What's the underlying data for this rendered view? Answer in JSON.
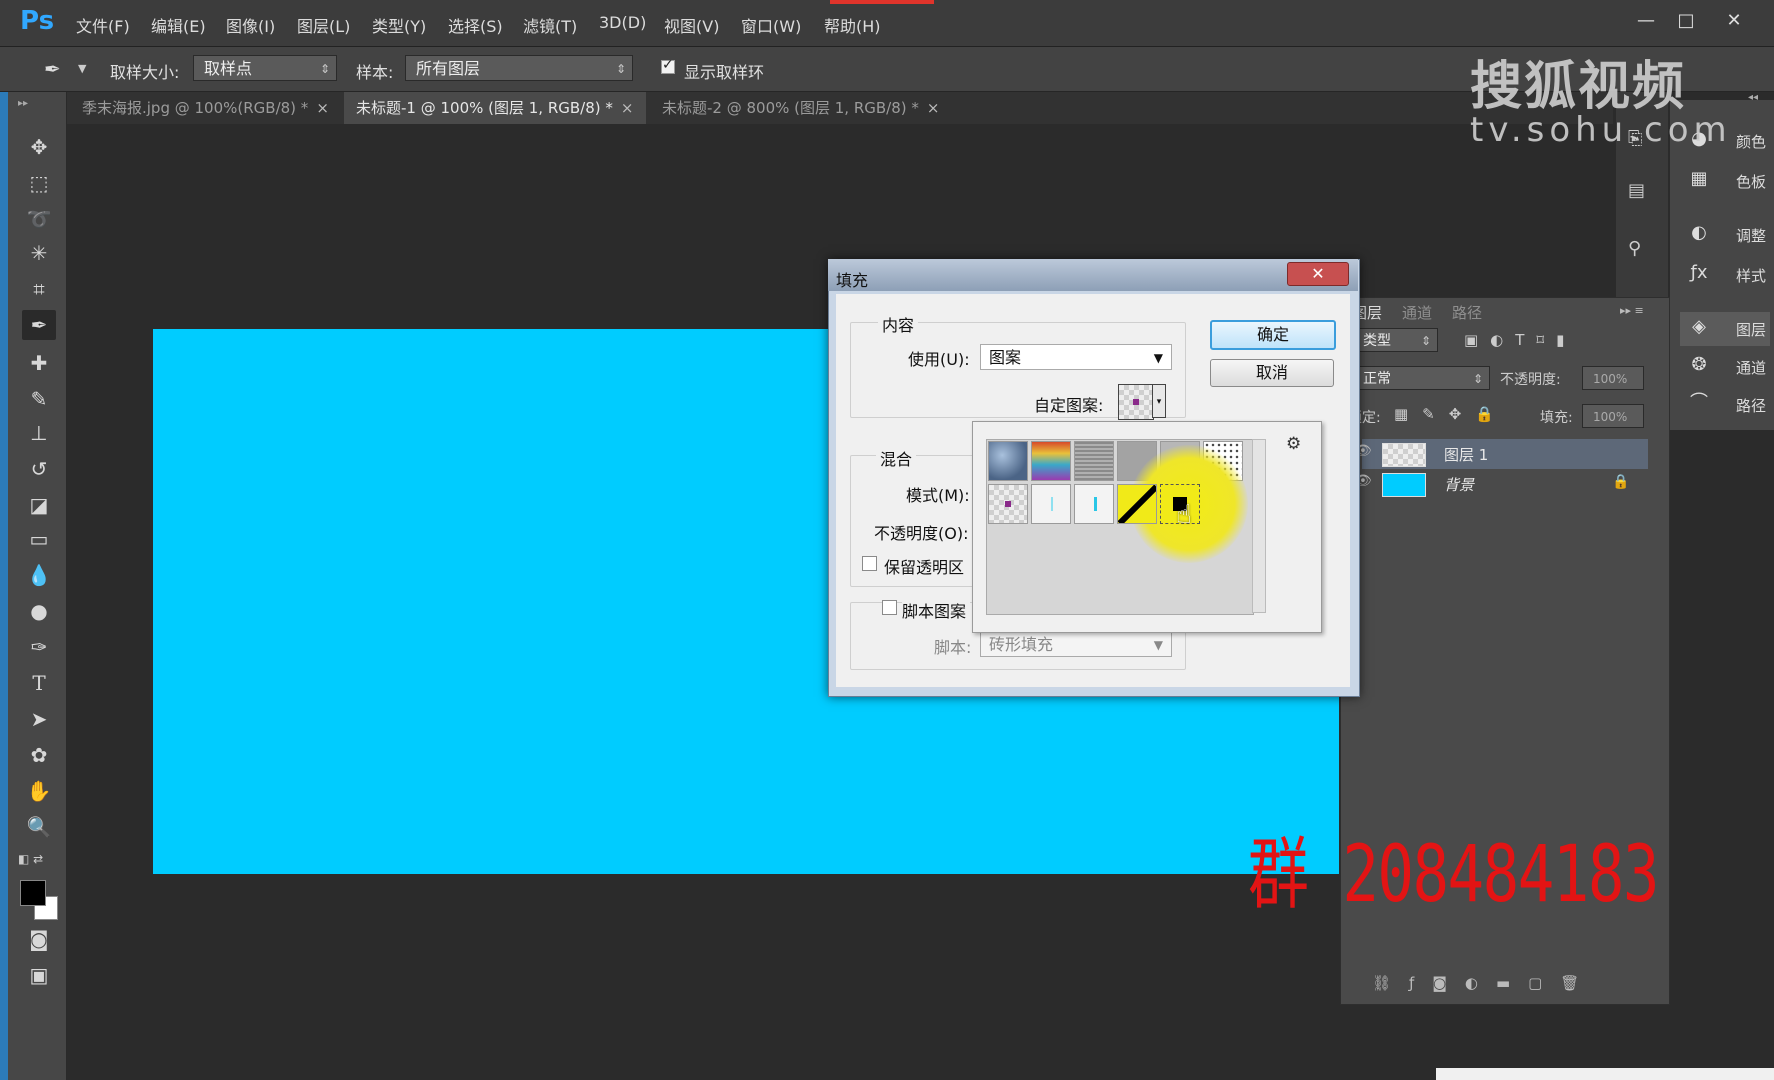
{
  "app": {
    "logo": "Ps",
    "menu": [
      "文件(F)",
      "编辑(E)",
      "图像(I)",
      "图层(L)",
      "类型(Y)",
      "选择(S)",
      "滤镜(T)",
      "3D(D)",
      "视图(V)",
      "窗口(W)",
      "帮助(H)"
    ],
    "window_controls": {
      "minimize": "—",
      "maximize": "□",
      "close": "✕"
    }
  },
  "options_bar": {
    "sample_size_label": "取样大小:",
    "sample_size_value": "取样点",
    "sample_label": "样本:",
    "sample_value": "所有图层",
    "show_ring_label": "显示取样环",
    "show_ring_checked": true
  },
  "tabs": [
    {
      "label": "季末海报.jpg @ 100%(RGB/8) *",
      "active": false
    },
    {
      "label": "未标题-1 @ 100% (图层 1, RGB/8) *",
      "active": true
    },
    {
      "label": "未标题-2 @ 800% (图层 1, RGB/8) *",
      "active": false
    }
  ],
  "tab_close_glyph": "×",
  "toolbar": {
    "icons": [
      "move-icon",
      "marquee-icon",
      "lasso-icon",
      "magic-wand-icon",
      "crop-icon",
      "eyedropper-icon",
      "healing-brush-icon",
      "brush-icon",
      "clone-stamp-icon",
      "history-brush-icon",
      "eraser-icon",
      "gradient-icon",
      "blur-icon",
      "dodge-icon",
      "pen-icon",
      "type-icon",
      "path-selection-icon",
      "shape-icon",
      "hand-icon",
      "zoom-icon"
    ],
    "active_tool": "eyedropper-icon"
  },
  "canvas": {
    "color": "#00ccff"
  },
  "watermark": {
    "title": "搜狐视频",
    "url": "tv.sohu.com"
  },
  "overlay_text": "群 208484183",
  "right_dock": [
    {
      "icon": "color-icon",
      "label": "颜色"
    },
    {
      "icon": "swatches-icon",
      "label": "色板"
    },
    {
      "icon": "adjustments-icon",
      "label": "调整"
    },
    {
      "icon": "styles-icon",
      "label": "样式"
    },
    {
      "icon": "layers-icon",
      "label": "图层"
    },
    {
      "icon": "channels-icon",
      "label": "通道"
    },
    {
      "icon": "paths-icon",
      "label": "路径"
    }
  ],
  "layers_panel": {
    "tabs": [
      "图层",
      "通道",
      "路径"
    ],
    "filter_label": "类型",
    "blend_mode": "正常",
    "opacity_label": "不透明度:",
    "opacity_value": "100%",
    "lock_label": "锁定:",
    "fill_label": "填充:",
    "fill_value": "100%",
    "layers": [
      {
        "name": "图层 1",
        "selected": true,
        "thumb": "transparent"
      },
      {
        "name": "背景",
        "selected": false,
        "thumb": "#00ccff",
        "locked": true
      }
    ]
  },
  "fill_dialog": {
    "title": "填充",
    "close_glyph": "✕",
    "content_group": "内容",
    "use_label": "使用(U):",
    "use_value": "图案",
    "custom_pattern_label": "自定图案:",
    "blend_group": "混合",
    "mode_label": "模式(M):",
    "opacity_label": "不透明度(O):",
    "preserve_label": "保留透明区",
    "script_label": "脚本图案",
    "script_field_label": "脚本:",
    "script_value": "砖形填充",
    "ok": "确定",
    "cancel": "取消"
  },
  "pattern_picker": {
    "gear_glyph": "⚙",
    "swatches": [
      {
        "name": "bubbles-pattern",
        "color": "#6a86a8"
      },
      {
        "name": "tie-dye-pattern",
        "color": "#d96a3a"
      },
      {
        "name": "gray-granite-pattern",
        "color": "#9a9a9a"
      },
      {
        "name": "gray-pattern",
        "color": "#a0a0a0"
      },
      {
        "name": "dotted-grid-pattern",
        "color": "#f4f4f4"
      },
      {
        "name": "dot-pattern",
        "color": "#8a2a8a"
      },
      {
        "name": "cyan-line-pattern-1",
        "color": "#29c6e6"
      },
      {
        "name": "cyan-line-pattern-2",
        "color": "#29c6e6"
      },
      {
        "name": "diagonal-stripe-pattern",
        "color": "#000000"
      },
      {
        "name": "black-square-pattern",
        "color": "#000000"
      }
    ]
  }
}
